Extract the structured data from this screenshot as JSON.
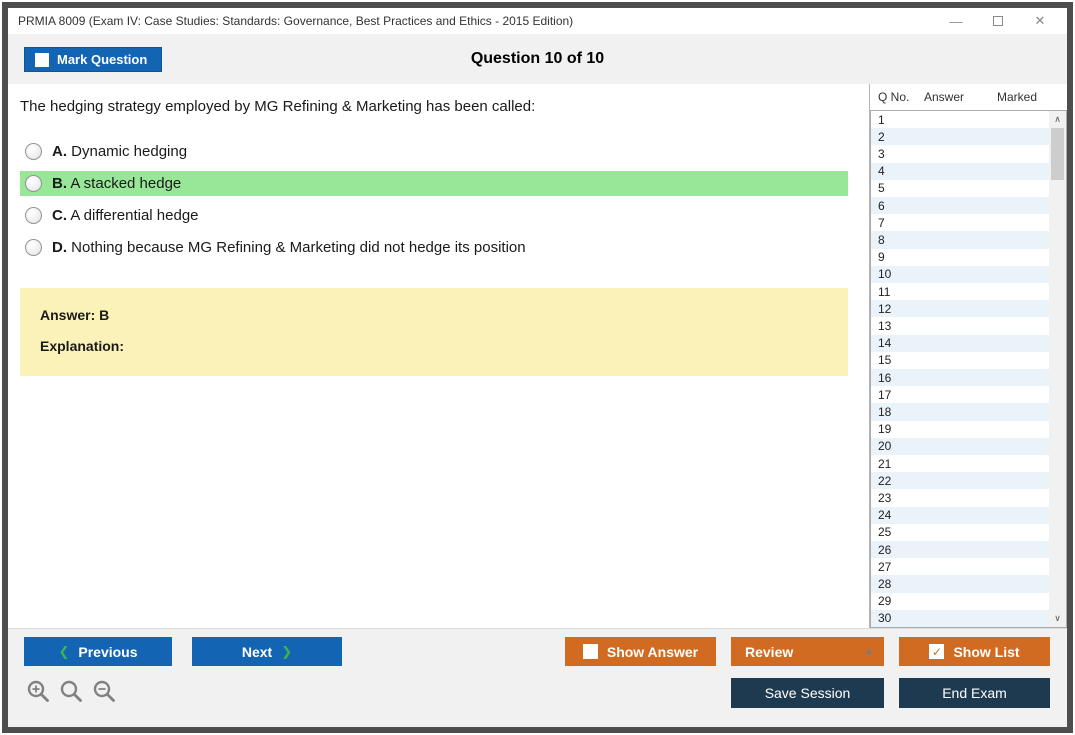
{
  "window": {
    "title": "PRMIA 8009 (Exam IV: Case Studies: Standards: Governance, Best Practices and Ethics - 2015 Edition)",
    "icons": {
      "minimize": "—",
      "close": "✕",
      "prev_chevron": "❮",
      "next_chevron": "❯",
      "review_arrow": "▲",
      "check": "✓",
      "scroll_up": "∧",
      "scroll_down": "∨"
    }
  },
  "header": {
    "mark_question_label": "Mark Question",
    "question_counter": "Question 10 of 10"
  },
  "question": {
    "text": "The hedging strategy employed by MG Refining & Marketing has been called:",
    "options": [
      {
        "letter": "A.",
        "text": "Dynamic hedging",
        "highlighted": false
      },
      {
        "letter": "B.",
        "text": "A stacked hedge",
        "highlighted": true
      },
      {
        "letter": "C.",
        "text": "A differential hedge",
        "highlighted": false
      },
      {
        "letter": "D.",
        "text": "Nothing because MG Refining & Marketing did not hedge its position",
        "highlighted": false
      }
    ]
  },
  "answer_panel": {
    "answer": "Answer: B",
    "explanation": "Explanation:"
  },
  "sidebar": {
    "columns": [
      "Q No.",
      "Answer",
      "Marked"
    ],
    "rows": [
      {
        "q": "1",
        "answer": "",
        "marked": ""
      },
      {
        "q": "2",
        "answer": "",
        "marked": ""
      },
      {
        "q": "3",
        "answer": "",
        "marked": ""
      },
      {
        "q": "4",
        "answer": "",
        "marked": ""
      },
      {
        "q": "5",
        "answer": "",
        "marked": ""
      },
      {
        "q": "6",
        "answer": "",
        "marked": ""
      },
      {
        "q": "7",
        "answer": "",
        "marked": ""
      },
      {
        "q": "8",
        "answer": "",
        "marked": ""
      },
      {
        "q": "9",
        "answer": "",
        "marked": ""
      },
      {
        "q": "10",
        "answer": "",
        "marked": ""
      },
      {
        "q": "11",
        "answer": "",
        "marked": ""
      },
      {
        "q": "12",
        "answer": "",
        "marked": ""
      },
      {
        "q": "13",
        "answer": "",
        "marked": ""
      },
      {
        "q": "14",
        "answer": "",
        "marked": ""
      },
      {
        "q": "15",
        "answer": "",
        "marked": ""
      },
      {
        "q": "16",
        "answer": "",
        "marked": ""
      },
      {
        "q": "17",
        "answer": "",
        "marked": ""
      },
      {
        "q": "18",
        "answer": "",
        "marked": ""
      },
      {
        "q": "19",
        "answer": "",
        "marked": ""
      },
      {
        "q": "20",
        "answer": "",
        "marked": ""
      },
      {
        "q": "21",
        "answer": "",
        "marked": ""
      },
      {
        "q": "22",
        "answer": "",
        "marked": ""
      },
      {
        "q": "23",
        "answer": "",
        "marked": ""
      },
      {
        "q": "24",
        "answer": "",
        "marked": ""
      },
      {
        "q": "25",
        "answer": "",
        "marked": ""
      },
      {
        "q": "26",
        "answer": "",
        "marked": ""
      },
      {
        "q": "27",
        "answer": "",
        "marked": ""
      },
      {
        "q": "28",
        "answer": "",
        "marked": ""
      },
      {
        "q": "29",
        "answer": "",
        "marked": ""
      },
      {
        "q": "30",
        "answer": "",
        "marked": ""
      }
    ]
  },
  "footer": {
    "previous": "Previous",
    "next": "Next",
    "show_answer": "Show Answer",
    "review": "Review",
    "show_list": "Show List",
    "save_session": "Save Session",
    "end_exam": "End Exam",
    "show_answer_checked": false,
    "show_list_checked": true
  },
  "colors": {
    "blue": "#1464B4",
    "orange": "#D26B22",
    "navy": "#1E3A50",
    "green": "#98E698",
    "yellow": "#FAF2B8",
    "rowtint": "#EBF3FA",
    "band": "#F1F1F1",
    "frame": "#4E4E4E",
    "chevgreen": "#3CB54A"
  }
}
